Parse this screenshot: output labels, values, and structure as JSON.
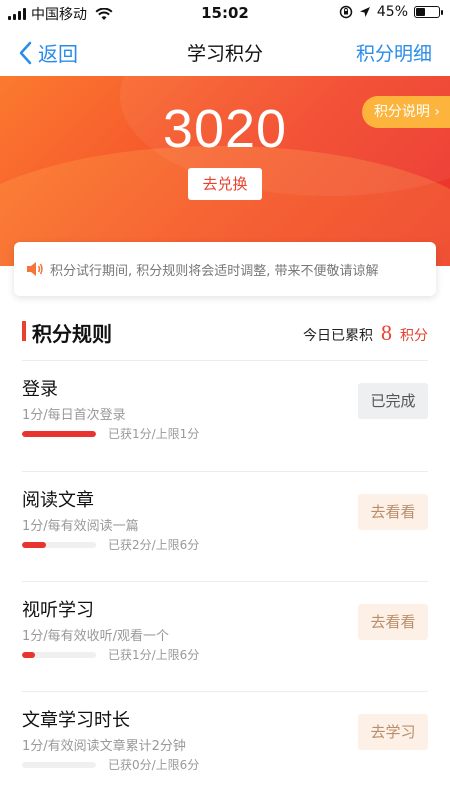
{
  "status_bar": {
    "carrier": "中国移动",
    "time": "15:02",
    "battery_percent": "45%",
    "battery_level": 0.45
  },
  "nav": {
    "back_label": "返回",
    "title": "学习积分",
    "right_label": "积分明细"
  },
  "hero": {
    "points": "3020",
    "redeem_label": "去兑换",
    "explain_label": "积分说明 ›"
  },
  "notice": {
    "text": "积分试行期间, 积分规则将会适时调整, 带来不便敬请谅解"
  },
  "rules": {
    "title": "积分规则",
    "today_label": "今日已累积",
    "today_value": "8",
    "today_unit": "积分"
  },
  "tasks": [
    {
      "name": "登录",
      "desc": "1分/每日首次登录",
      "status": "已获1分/上限1分",
      "progress": 1.0,
      "button": "已完成",
      "button_style": "done"
    },
    {
      "name": "阅读文章",
      "desc": "1分/每有效阅读一篇",
      "status": "已获2分/上限6分",
      "progress": 0.33,
      "button": "去看看",
      "button_style": "go"
    },
    {
      "name": "视听学习",
      "desc": "1分/每有效收听/观看一个",
      "status": "已获1分/上限6分",
      "progress": 0.17,
      "button": "去看看",
      "button_style": "go"
    },
    {
      "name": "文章学习时长",
      "desc": "1分/有效阅读文章累计2分钟",
      "status": "已获0分/上限6分",
      "progress": 0.0,
      "button": "去学习",
      "button_style": "go"
    }
  ],
  "icons": {
    "signal": "signal-icon",
    "wifi": "wifi-icon",
    "orientation_lock": "orientation-lock-icon",
    "location": "location-icon",
    "battery": "battery-icon",
    "back": "chevron-left-icon",
    "speaker": "speaker-icon"
  },
  "colors": {
    "accent_blue": "#2a8ce8",
    "accent_red": "#e8412e",
    "hero_orange": "#fb7a2f",
    "explain_yellow": "#fcb43d"
  }
}
